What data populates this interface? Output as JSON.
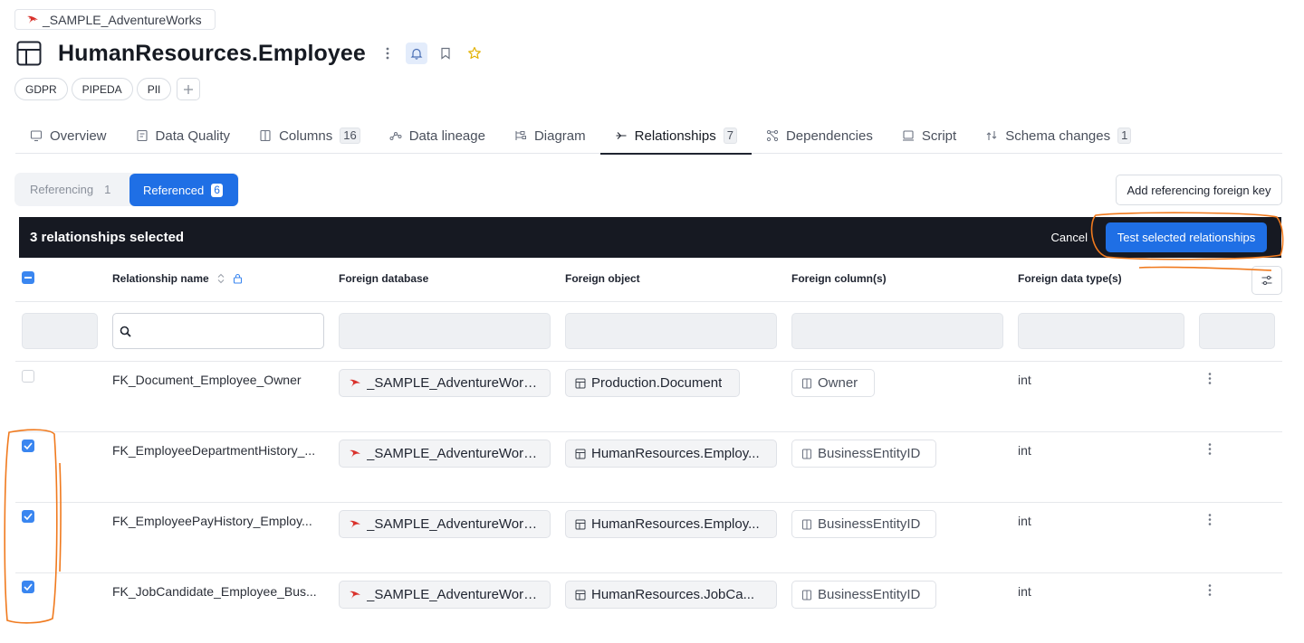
{
  "breadcrumb": {
    "database": "_SAMPLE_AdventureWorks"
  },
  "page": {
    "title": "HumanResources.Employee",
    "tags": [
      "GDPR",
      "PIPEDA",
      "PII"
    ]
  },
  "tabs": [
    {
      "label": "Overview",
      "count": ""
    },
    {
      "label": "Data Quality",
      "count": ""
    },
    {
      "label": "Columns",
      "count": "16"
    },
    {
      "label": "Data lineage",
      "count": ""
    },
    {
      "label": "Diagram",
      "count": ""
    },
    {
      "label": "Relationships",
      "count": "7",
      "active": true
    },
    {
      "label": "Dependencies",
      "count": ""
    },
    {
      "label": "Script",
      "count": ""
    },
    {
      "label": "Schema changes",
      "count": "1"
    }
  ],
  "segment": {
    "referencing_label": "Referencing",
    "referencing_count": "1",
    "referenced_label": "Referenced",
    "referenced_count": "6"
  },
  "actions": {
    "add_fk_label": "Add referencing foreign key"
  },
  "selection_bar": {
    "text": "3 relationships selected",
    "cancel_label": "Cancel",
    "test_label": "Test selected relationships"
  },
  "columns": {
    "relationship_name": "Relationship name",
    "foreign_database": "Foreign database",
    "foreign_object": "Foreign object",
    "foreign_columns": "Foreign column(s)",
    "foreign_data_types": "Foreign data type(s)"
  },
  "filters": {
    "search_value": ""
  },
  "rows": [
    {
      "checked": false,
      "name": "FK_Document_Employee_Owner",
      "database": "_SAMPLE_AdventureWork...",
      "object": "Production.Document",
      "column": "Owner",
      "dtype": "int"
    },
    {
      "checked": true,
      "name": "FK_EmployeeDepartmentHistory_...",
      "database": "_SAMPLE_AdventureWork...",
      "object": "HumanResources.Employ...",
      "column": "BusinessEntityID",
      "dtype": "int"
    },
    {
      "checked": true,
      "name": "FK_EmployeePayHistory_Employ...",
      "database": "_SAMPLE_AdventureWork...",
      "object": "HumanResources.Employ...",
      "column": "BusinessEntityID",
      "dtype": "int"
    },
    {
      "checked": true,
      "name": "FK_JobCandidate_Employee_Bus...",
      "database": "_SAMPLE_AdventureWork...",
      "object": "HumanResources.JobCa...",
      "column": "BusinessEntityID",
      "dtype": "int"
    }
  ],
  "colors": {
    "accent": "#1f6fe5",
    "selection_bar": "#161922",
    "annotation": "#f07a1e"
  }
}
